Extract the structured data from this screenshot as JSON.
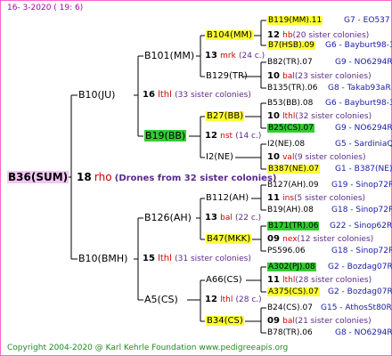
{
  "date_line": "16-  3-2020  ( 19:  6)",
  "root": {
    "label": "B36(SUM)"
  },
  "root_note": {
    "num": "18",
    "word": "rho",
    "text": "(Drones from 32 sister colonies)"
  },
  "gen1": [
    {
      "label": "B10(JU)",
      "num": "16",
      "word": "lthl",
      "sisters": "(33 sister colonies)"
    },
    {
      "label": "B10(BMH)",
      "num": "15",
      "word": "lthl",
      "sisters": "(31 sister colonies)"
    }
  ],
  "gen2": [
    {
      "label": "B101(MM)",
      "num": "13",
      "word": "mrk",
      "sisters": "(24 c.)"
    },
    {
      "label": "B19(BB)",
      "num": "12",
      "word": "nst",
      "sisters": "(14 c.)"
    },
    {
      "label": "B126(AH)",
      "num": "13",
      "word": "bal",
      "sisters": "(22 c.)"
    },
    {
      "label": "A5(CS)",
      "num": "12",
      "word": "lthl",
      "sisters": "(28 c.)"
    }
  ],
  "gen3": [
    {
      "label": "B104(MM)",
      "num": "12",
      "word": "hb",
      "sisters": "(20 sister colonies)"
    },
    {
      "label": "B129(TR)",
      "num": "10",
      "word": "bal",
      "sisters": "(23 sister colonies)"
    },
    {
      "label": "B27(BB)",
      "num": "10",
      "word": "lthl",
      "sisters": "(32 sister colonies)"
    },
    {
      "label": "I2(NE)",
      "num": "10",
      "word": "val",
      "sisters": "(9 sister colonies)"
    },
    {
      "label": "B112(AH)",
      "num": "11",
      "word": "ins",
      "sisters": "(5 sister colonies)"
    },
    {
      "label": "B47(MKK)",
      "num": "09",
      "word": "nex",
      "sisters": "(12 sister colonies)"
    },
    {
      "label": "A66(CS)",
      "num": "11",
      "word": "lthl",
      "sisters": "(28 sister colonies)"
    },
    {
      "label": "B34(CS)",
      "num": "09",
      "word": "bal",
      "sisters": "(21 sister colonies)"
    }
  ],
  "gen4": [
    {
      "label": "B119(MM).11",
      "code": "G7 - EO537"
    },
    {
      "label": "B7(HSB).09",
      "code": "G6 - Bayburt98-3"
    },
    {
      "label": "B82(TR).07",
      "code": "G9 - NO6294R"
    },
    {
      "label": "B135(TR).06",
      "code": "G8 - Takab93aR"
    },
    {
      "label": "B53(BB).08",
      "code": "G6 - Bayburt98-3"
    },
    {
      "label": "B25(CS).07",
      "code": "G9 - NO6294R"
    },
    {
      "label": "I2(NE).08",
      "code": "G5 - SardiniaQ"
    },
    {
      "label": "B387(NE).07",
      "code": "G1 - B387(NE)"
    },
    {
      "label": "B127(AH).09",
      "code": "G19 - Sinop72R"
    },
    {
      "label": "B19(AH).08",
      "code": "G18 - Sinop72R"
    },
    {
      "label": "B171(TR).06",
      "code": "G22 - Sinop62R"
    },
    {
      "label": "PS596.06",
      "code": "G18 - Sinop72R"
    },
    {
      "label": "A302(PJ).08",
      "code": "G2 - Bozdag07R"
    },
    {
      "label": "A375(CS).07",
      "code": "G2 - Bozdag07R"
    },
    {
      "label": "B24(CS).07",
      "code": "G15 - AthosSt80R"
    },
    {
      "label": "B78(TR).06",
      "code": "G8 - NO6294R"
    }
  ],
  "footer": "Copyright 2004-2020 @ Karl Kehrle Foundation    www.pedigreeapis.org"
}
